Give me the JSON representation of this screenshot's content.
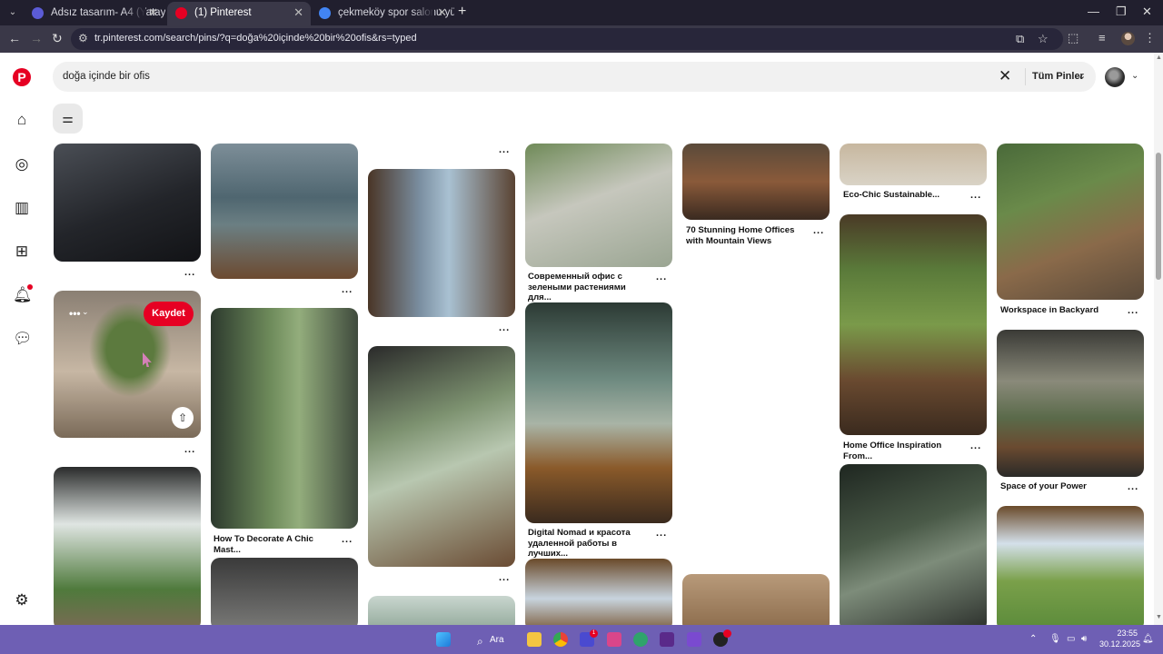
{
  "browser": {
    "tabs": [
      {
        "title": "Adsız tasarım- A4 (Yatay)",
        "favicon_color": "#5b5bd6"
      },
      {
        "title": "(1) Pinterest",
        "favicon_color": "#e60023"
      },
      {
        "title": "çekmeköy spor salonu yüzme h",
        "favicon_color": "#4285f4"
      }
    ],
    "url": "tr.pinterest.com/search/pins/?q=doğa%20içinde%20bir%20ofis&rs=typed"
  },
  "search": {
    "query": "doğa içinde bir ofis",
    "scope_label": "Tüm Pinler"
  },
  "hover_pin": {
    "save_label": "Kaydet"
  },
  "pins": {
    "titles": {
      "col2_a": "How To Decorate A Chic Mast...",
      "col4_a": "Современный офис с зелеными растениями для...",
      "col4_b": "Digital Nomad и красота удаленной работы в лучших...",
      "col5_a": "70 Stunning Home Offices with Mountain Views",
      "col6_a": "Eco-Chic Sustainable...",
      "col6_b": "Home Office Inspiration From...",
      "col7_a": "Workspace in Backyard",
      "col7_b": "Space of your Power"
    },
    "more_label": "..."
  },
  "taskbar": {
    "search_label": "Ara",
    "time": "23:55",
    "date": "30.12.2025",
    "notification_count": "1"
  },
  "colors": {
    "pinterest_red": "#e60023",
    "taskbar": "#6e5fb4",
    "chrome_dark": "#211f2e"
  }
}
